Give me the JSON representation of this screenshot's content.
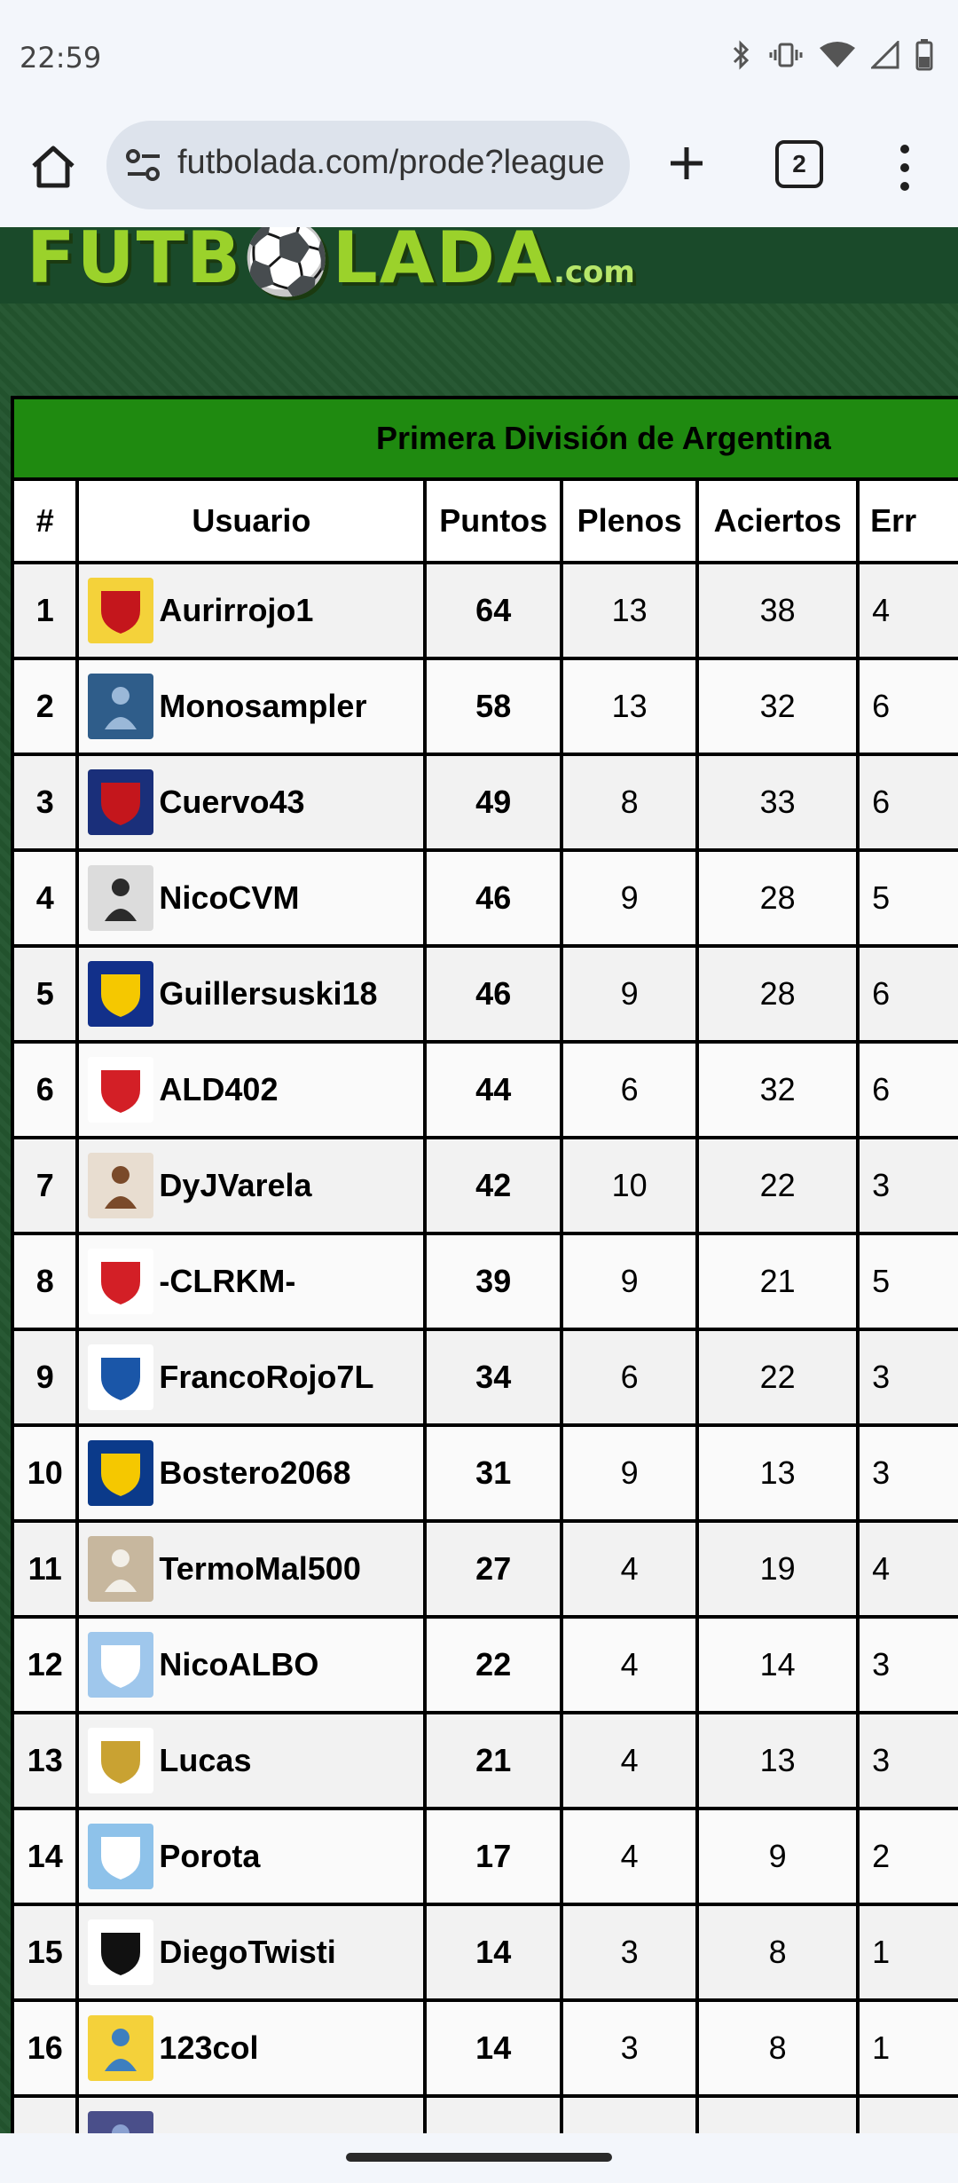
{
  "status_bar": {
    "time": "22:59"
  },
  "browser": {
    "url": "futbolada.com/prode?league",
    "tab_count": "2"
  },
  "site": {
    "logo_main": "FUTB⚽LADA",
    "logo_suffix": ".com"
  },
  "table": {
    "title": "Primera División de Argentina",
    "headers": [
      "#",
      "Usuario",
      "Puntos",
      "Plenos",
      "Aciertos",
      "Err"
    ],
    "rows": [
      {
        "rank": "1",
        "user": "Aurirrojo1",
        "puntos": "64",
        "plenos": "13",
        "aciertos": "38",
        "errores": "4"
      },
      {
        "rank": "2",
        "user": "Monosampler",
        "puntos": "58",
        "plenos": "13",
        "aciertos": "32",
        "errores": "6"
      },
      {
        "rank": "3",
        "user": "Cuervo43",
        "puntos": "49",
        "plenos": "8",
        "aciertos": "33",
        "errores": "6"
      },
      {
        "rank": "4",
        "user": "NicoCVM",
        "puntos": "46",
        "plenos": "9",
        "aciertos": "28",
        "errores": "5"
      },
      {
        "rank": "5",
        "user": "Guillersuski18",
        "puntos": "46",
        "plenos": "9",
        "aciertos": "28",
        "errores": "6"
      },
      {
        "rank": "6",
        "user": "ALD402",
        "puntos": "44",
        "plenos": "6",
        "aciertos": "32",
        "errores": "6"
      },
      {
        "rank": "7",
        "user": "DyJVarela",
        "puntos": "42",
        "plenos": "10",
        "aciertos": "22",
        "errores": "3"
      },
      {
        "rank": "8",
        "user": "-CLRKM-",
        "puntos": "39",
        "plenos": "9",
        "aciertos": "21",
        "errores": "5"
      },
      {
        "rank": "9",
        "user": "FrancoRojo7L",
        "puntos": "34",
        "plenos": "6",
        "aciertos": "22",
        "errores": "3"
      },
      {
        "rank": "10",
        "user": "Bostero2068",
        "puntos": "31",
        "plenos": "9",
        "aciertos": "13",
        "errores": "3"
      },
      {
        "rank": "11",
        "user": "TermoMal500",
        "puntos": "27",
        "plenos": "4",
        "aciertos": "19",
        "errores": "4"
      },
      {
        "rank": "12",
        "user": "NicoALBO",
        "puntos": "22",
        "plenos": "4",
        "aciertos": "14",
        "errores": "3"
      },
      {
        "rank": "13",
        "user": "Lucas",
        "puntos": "21",
        "plenos": "4",
        "aciertos": "13",
        "errores": "3"
      },
      {
        "rank": "14",
        "user": "Porota",
        "puntos": "17",
        "plenos": "4",
        "aciertos": "9",
        "errores": "2"
      },
      {
        "rank": "15",
        "user": "DiegoTwisti",
        "puntos": "14",
        "plenos": "3",
        "aciertos": "8",
        "errores": "1"
      },
      {
        "rank": "16",
        "user": "123col",
        "puntos": "14",
        "plenos": "3",
        "aciertos": "8",
        "errores": "1"
      },
      {
        "rank": "",
        "user": "",
        "puntos": "",
        "plenos": "",
        "aciertos": "",
        "errores": ""
      }
    ]
  },
  "avatars": [
    {
      "icon": "shield-red-yellow-icon",
      "bg": "#f4d23a",
      "fg": "#c4161c"
    },
    {
      "icon": "monkey-photo-icon",
      "bg": "#2f5d8a",
      "fg": "#9ab8d8"
    },
    {
      "icon": "san-lorenzo-shield-icon",
      "bg": "#1a2f7a",
      "fg": "#c4161c"
    },
    {
      "icon": "man-photo-icon",
      "bg": "#dcdcdc",
      "fg": "#2b2b2b"
    },
    {
      "icon": "rosario-central-shield-icon",
      "bg": "#12308a",
      "fg": "#f5c800"
    },
    {
      "icon": "argentinos-badge-icon",
      "bg": "#ffffff",
      "fg": "#d31f26"
    },
    {
      "icon": "woman-photo-icon",
      "bg": "#e8ddd0",
      "fg": "#7a4a2a"
    },
    {
      "icon": "river-plate-shield-icon",
      "bg": "#ffffff",
      "fg": "#d31f26"
    },
    {
      "icon": "independiente-badge-icon",
      "bg": "#ffffff",
      "fg": "#1a56a8"
    },
    {
      "icon": "boca-juniors-shield-icon",
      "bg": "#0b3a8a",
      "fg": "#f5c800"
    },
    {
      "icon": "skeleton-photo-icon",
      "bg": "#c7b79e",
      "fg": "#f2efe8"
    },
    {
      "icon": "gimnasia-shield-icon",
      "bg": "#9fc7ec",
      "fg": "#ffffff"
    },
    {
      "icon": "real-madrid-crest-icon",
      "bg": "#ffffff",
      "fg": "#c9a232"
    },
    {
      "icon": "atletico-tucuman-shield-icon",
      "bg": "#8ec2ea",
      "fg": "#ffffff"
    },
    {
      "icon": "chaco-for-ever-shield-icon",
      "bg": "#ffffff",
      "fg": "#111111"
    },
    {
      "icon": "spongebob-photo-icon",
      "bg": "#f4d13a",
      "fg": "#3d7fbf"
    },
    {
      "icon": "partial-photo-icon",
      "bg": "#4a4f8a",
      "fg": "#8aa0d0"
    }
  ]
}
